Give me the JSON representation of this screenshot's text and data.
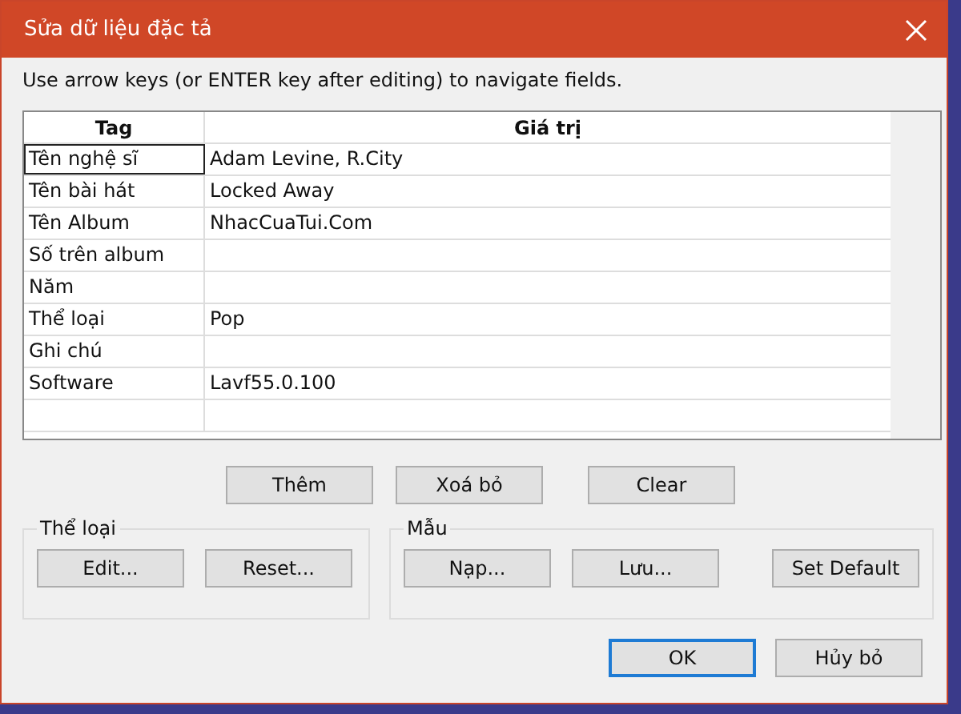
{
  "window": {
    "title": "Sửa dữ liệu đặc tả"
  },
  "instructions": "Use arrow keys (or ENTER key after editing) to navigate fields.",
  "table": {
    "columns": [
      "Tag",
      "Giá trị"
    ],
    "rows": [
      {
        "tag": "Tên nghệ sĩ",
        "value": "Adam Levine, R.City",
        "focused": true
      },
      {
        "tag": "Tên bài hát",
        "value": "Locked Away",
        "focused": false
      },
      {
        "tag": "Tên Album",
        "value": "NhacCuaTui.Com",
        "focused": false
      },
      {
        "tag": "Số trên album",
        "focused": false
      },
      {
        "tag": "Năm",
        "focused": false
      },
      {
        "tag": "Thể loại",
        "value": "Pop",
        "focused": false
      },
      {
        "tag": "Ghi chú",
        "focused": false
      },
      {
        "tag": "Software",
        "value": "Lavf55.0.100",
        "focused": false
      }
    ]
  },
  "table_buttons": [
    "Thêm",
    "Xoá bỏ",
    "Clear"
  ],
  "groups": [
    {
      "label": "Thể loại",
      "buttons": [
        "Edit...",
        "Reset..."
      ]
    },
    {
      "label": "Mẫu",
      "buttons": [
        "Nạp...",
        "Lưu...",
        "Set Default"
      ]
    }
  ],
  "dialog_buttons": [
    {
      "label": "OK",
      "default": true
    },
    {
      "label": "Hủy bỏ",
      "default": false
    }
  ]
}
